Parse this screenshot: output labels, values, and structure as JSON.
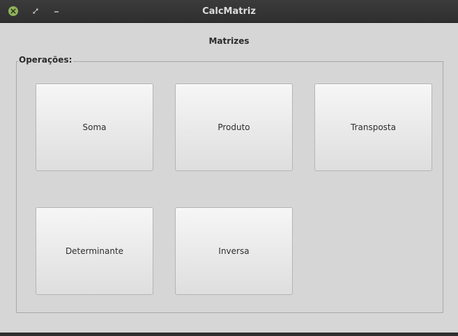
{
  "window": {
    "title": "CalcMatriz",
    "controls": {
      "close_icon": "close-icon",
      "restore_icon": "restore-icon",
      "minimize_icon": "minimize-icon",
      "close_color": "#8fb35a"
    }
  },
  "main": {
    "heading": "Matrizes",
    "group": {
      "legend": "Operações:",
      "buttons": [
        {
          "label": "Soma"
        },
        {
          "label": "Produto"
        },
        {
          "label": "Transposta"
        },
        {
          "label": "Determinante"
        },
        {
          "label": "Inversa"
        }
      ]
    }
  }
}
